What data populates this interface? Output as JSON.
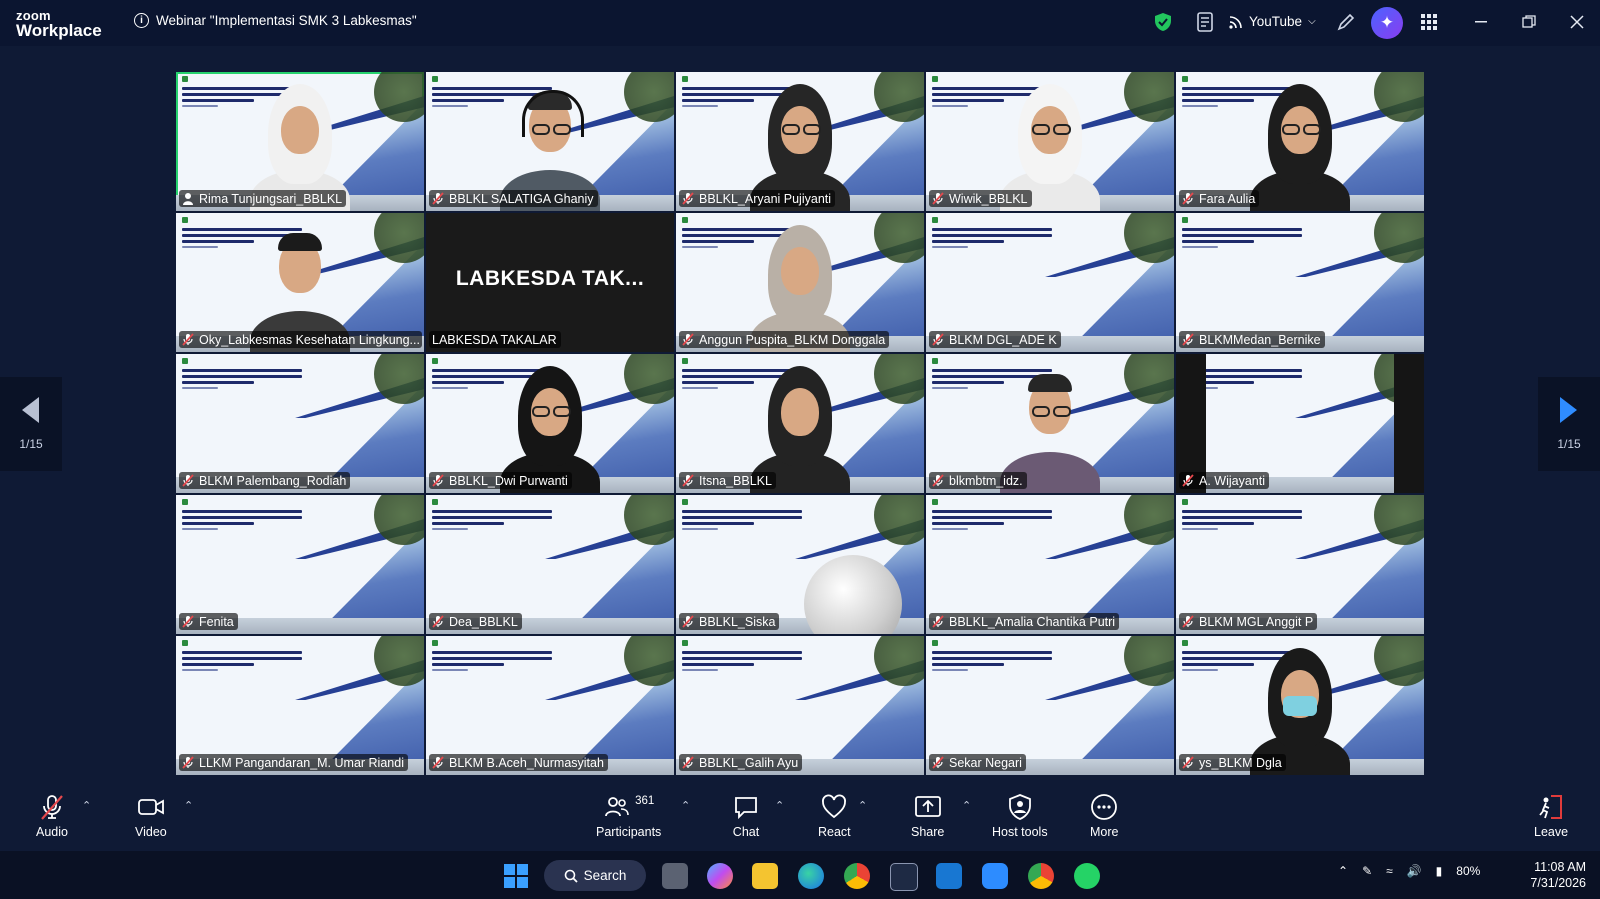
{
  "app": {
    "brand_top": "zoom",
    "brand_bottom": "Workplace"
  },
  "meeting": {
    "title": "Webinar \"Implementasi SMK 3 Labkesmas\""
  },
  "titlebar": {
    "stream_label": "YouTube"
  },
  "pagination": {
    "left": "1/15",
    "right": "1/15"
  },
  "participants_tiles": [
    {
      "name": "Rima Tunjungsari_BBLKL",
      "active": true
    },
    {
      "name": "BBLKL SALATIGA Ghaniy"
    },
    {
      "name": "BBLKL_Aryani Pujiyanti"
    },
    {
      "name": "Wiwik_BBLKL"
    },
    {
      "name": "Fara Aulia"
    },
    {
      "name": "Oky_Labkesmas Kesehatan Lingkung..."
    },
    {
      "name": "LABKESDA TAKALAR",
      "display": "LABKESDA TAK..."
    },
    {
      "name": "Anggun Puspita_BLKM Donggala"
    },
    {
      "name": "BLKM DGL_ADE K"
    },
    {
      "name": "BLKMMedan_Bernike"
    },
    {
      "name": "BLKM Palembang_Rodiah"
    },
    {
      "name": "BBLKL_Dwi Purwanti"
    },
    {
      "name": "Itsna_BBLKL"
    },
    {
      "name": "blkmbtm_idz."
    },
    {
      "name": "A. Wijayanti"
    },
    {
      "name": "Fenita"
    },
    {
      "name": "Dea_BBLKL"
    },
    {
      "name": "BBLKL_Siska"
    },
    {
      "name": "BBLKL_Amalia Chantika Putri"
    },
    {
      "name": "BLKM MGL Anggit P"
    },
    {
      "name": "LLKM Pangandaran_M. Umar Riandi"
    },
    {
      "name": "BLKM B.Aceh_Nurmasyitah"
    },
    {
      "name": "BBLKL_Galih Ayu"
    },
    {
      "name": "Sekar Negari"
    },
    {
      "name": "ys_BLKM Dgla"
    }
  ],
  "controls": {
    "audio": "Audio",
    "video": "Video",
    "participants": "Participants",
    "participants_count": "361",
    "chat": "Chat",
    "react": "React",
    "share": "Share",
    "host_tools": "Host tools",
    "more": "More",
    "leave": "Leave"
  },
  "taskbar": {
    "search": "Search",
    "battery": "80%",
    "time": "11:08 AM",
    "date": "7/31/2026"
  },
  "colors": {
    "active_border": "#26d26e",
    "leave_red": "#e03b3b",
    "muted_red": "#e5484d"
  }
}
